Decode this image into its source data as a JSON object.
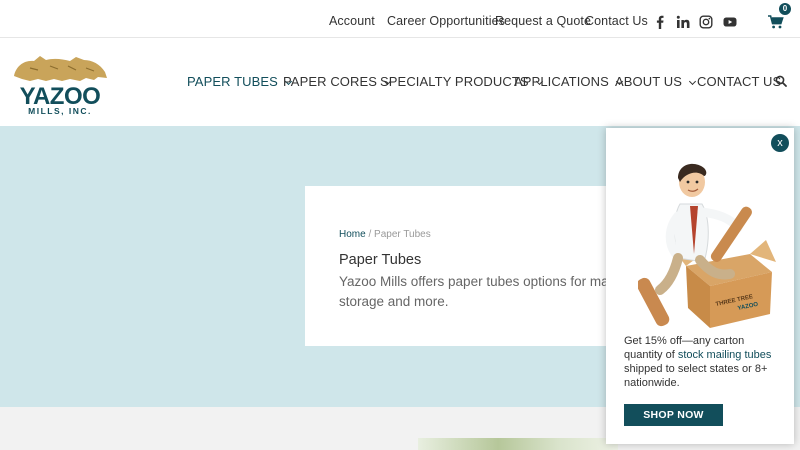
{
  "topbar": {
    "links": [
      "Account",
      "Career Opportunities",
      "Request a Quote",
      "Contact Us"
    ],
    "social_icons": [
      "facebook-icon",
      "linkedin-icon",
      "instagram-icon",
      "youtube-icon"
    ],
    "cart_count": "0"
  },
  "logo": {
    "name": "YAZOO",
    "sub": "MILLS, INC."
  },
  "nav": {
    "items": [
      {
        "label": "PAPER TUBES",
        "dropdown": true
      },
      {
        "label": "PAPER CORES",
        "dropdown": true
      },
      {
        "label": "SPECIALTY PRODUCTS",
        "dropdown": true
      },
      {
        "label": "APPLICATIONS",
        "dropdown": true
      },
      {
        "label": "ABOUT US",
        "dropdown": true
      },
      {
        "label": "CONTACT US",
        "dropdown": false
      }
    ]
  },
  "hero": {
    "breadcrumb_home": "Home",
    "breadcrumb_sep": "/",
    "breadcrumb_current": "Paper Tubes",
    "title": "Paper Tubes",
    "description": "Yazoo Mills offers paper tubes options for mailing, storage and more."
  },
  "popup": {
    "close_label": "x",
    "promo_pre": "Get 15% off—any carton quantity of ",
    "promo_link": "stock mailing tubes",
    "promo_post": " shipped to select states or 8+ nationwide.",
    "cta": "SHOP NOW",
    "box_text_1": "THREE TREE",
    "box_text_2": "YAZOO"
  },
  "colors": {
    "brand": "#124e5b",
    "hero_bg": "#cfe6ea",
    "logo_gold": "#c9a45a"
  }
}
